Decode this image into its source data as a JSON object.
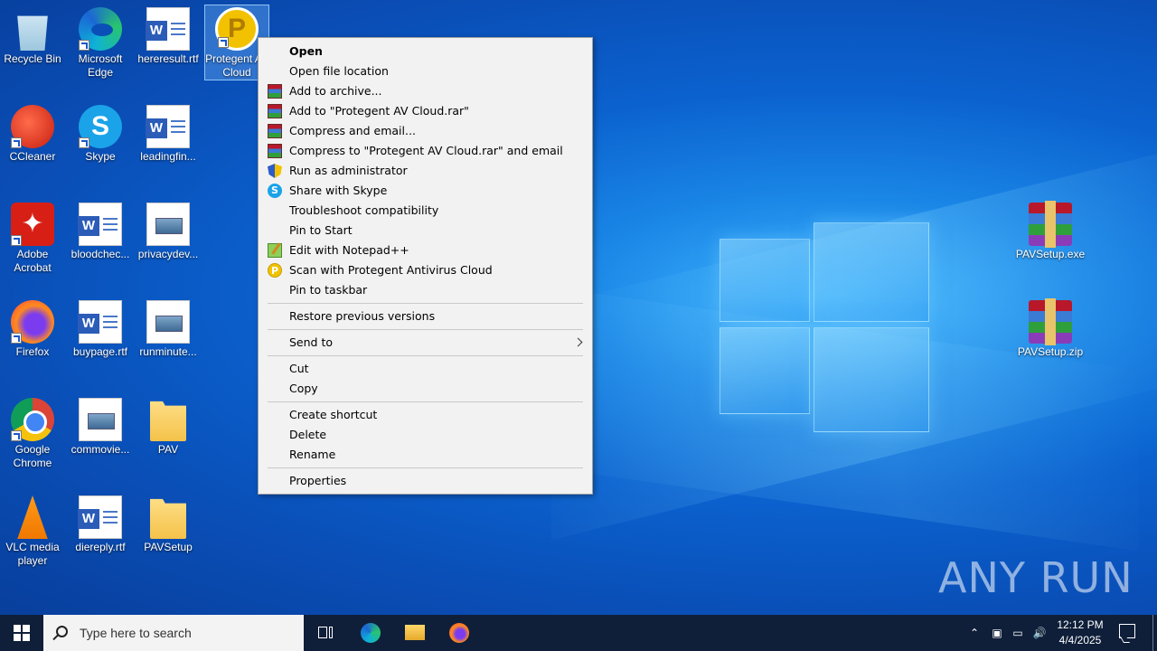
{
  "desktop_icons": [
    {
      "label": "Recycle Bin"
    },
    {
      "label": "Microsoft Edge"
    },
    {
      "label": "hereresult.rtf"
    },
    {
      "label": "Protegent AV Cloud"
    },
    {
      "label": "CCleaner"
    },
    {
      "label": "Skype"
    },
    {
      "label": "leadingfin..."
    },
    {
      "label": "Adobe Acrobat"
    },
    {
      "label": "bloodchec..."
    },
    {
      "label": "privacydev..."
    },
    {
      "label": "Firefox"
    },
    {
      "label": "buypage.rtf"
    },
    {
      "label": "runminute..."
    },
    {
      "label": "Google Chrome"
    },
    {
      "label": "commovie..."
    },
    {
      "label": "PAV"
    },
    {
      "label": "VLC media player"
    },
    {
      "label": "diereply.rtf"
    },
    {
      "label": "PAVSetup"
    },
    {
      "label": "PAVSetup.exe"
    },
    {
      "label": "PAVSetup.zip"
    }
  ],
  "context_menu": {
    "items": [
      {
        "label": "Open"
      },
      {
        "label": "Open file location"
      },
      {
        "label": "Add to archive..."
      },
      {
        "label": "Add to \"Protegent  AV Cloud.rar\""
      },
      {
        "label": "Compress and email..."
      },
      {
        "label": "Compress to \"Protegent  AV Cloud.rar\" and email"
      },
      {
        "label": "Run as administrator"
      },
      {
        "label": "Share with Skype"
      },
      {
        "label": "Troubleshoot compatibility"
      },
      {
        "label": "Pin to Start"
      },
      {
        "label": "Edit with Notepad++"
      },
      {
        "label": "Scan with Protegent Antivirus Cloud"
      },
      {
        "label": "Pin to taskbar"
      },
      {
        "label": "Restore previous versions"
      },
      {
        "label": "Send to"
      },
      {
        "label": "Cut"
      },
      {
        "label": "Copy"
      },
      {
        "label": "Create shortcut"
      },
      {
        "label": "Delete"
      },
      {
        "label": "Rename"
      },
      {
        "label": "Properties"
      }
    ]
  },
  "watermark": "ANY RUN",
  "taskbar": {
    "search_placeholder": "Type here to search",
    "time": "12:12 PM",
    "date": "4/4/2025"
  },
  "colors": {
    "taskbar": "#0f1f3a",
    "menu_background": "#f2f2f2",
    "wallpaper_primary": "#0b62cf"
  }
}
